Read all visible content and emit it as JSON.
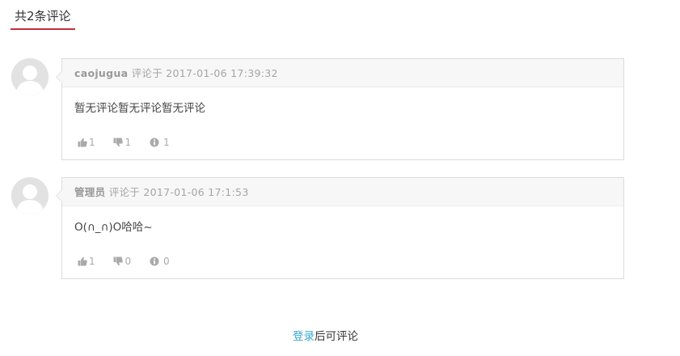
{
  "header": {
    "title": "共2条评论"
  },
  "comments": [
    {
      "author": "caojugua",
      "meta": "评论于 2017-01-06 17:39:32",
      "text": "暂无评论暂无评论暂无评论",
      "likes": "1",
      "dislikes": "1",
      "info": "1"
    },
    {
      "author": "管理员",
      "meta": "评论于 2017-01-06 17:1:53",
      "text": "O(∩_∩)O哈哈~",
      "likes": "1",
      "dislikes": "0",
      "info": "0"
    }
  ],
  "footer": {
    "login_link": "登录",
    "login_suffix": "后可评论"
  },
  "icons": {
    "like": "thumbs-up-icon",
    "dislike": "thumbs-down-icon",
    "info": "info-icon",
    "avatar": "default-user-avatar"
  },
  "colors": {
    "accent_underline": "#c0313c",
    "link": "#3aa8cf",
    "card_border": "#dcdcdc",
    "card_header_bg": "#f7f7f7"
  }
}
